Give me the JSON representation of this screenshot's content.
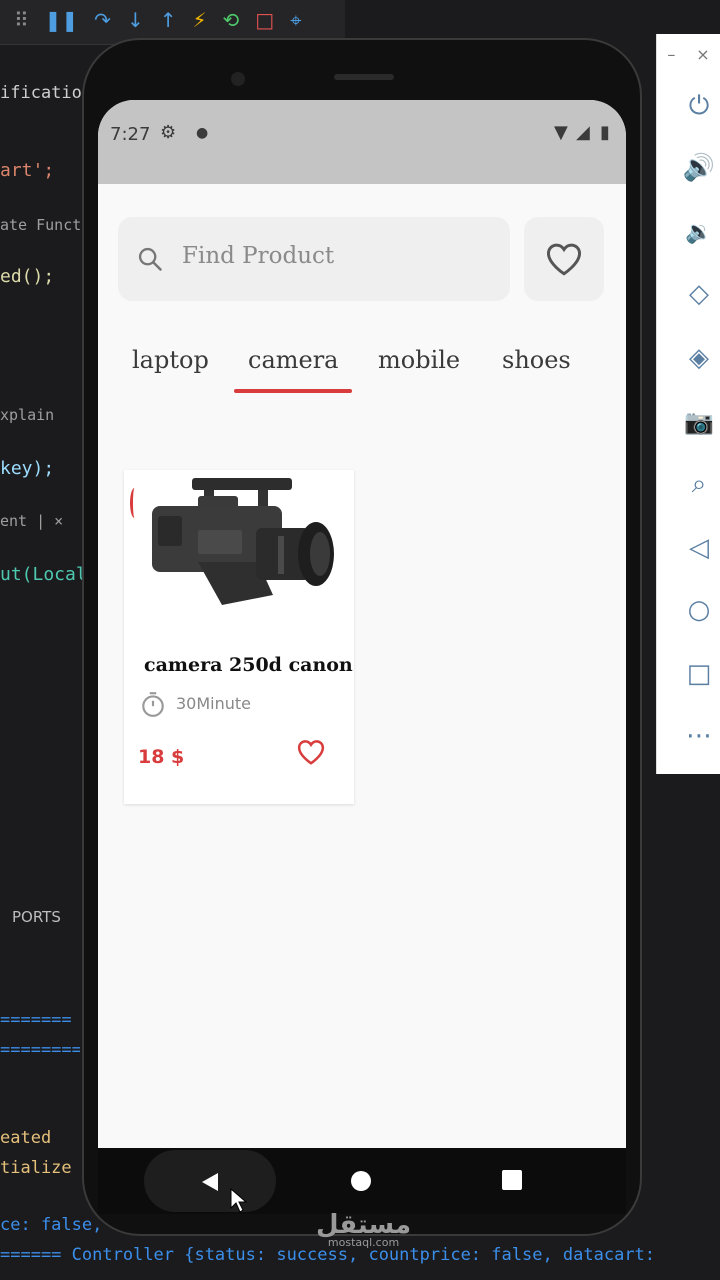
{
  "ide": {
    "file_tab": "ification.d",
    "code_lines": [
      {
        "text": "art';",
        "color": "#d9846b"
      },
      {
        "text": "ate Functio",
        "color": "#9e9e9e"
      },
      {
        "text": "ed();",
        "color": "#dcdcaa"
      },
      {
        "text": "xplain",
        "color": "#9e9e9e"
      },
      {
        "text": "key);",
        "color": "#9cdcfe"
      },
      {
        "text": "ent | ×",
        "color": "#9e9e9e"
      },
      {
        "text": "ut(Local",
        "color": "#4ec9b0"
      }
    ],
    "panel_tab": "PORTS",
    "terminal_lines": [
      {
        "text": "======= (",
        "color": "#3b8eea"
      },
      {
        "text": "==========",
        "color": "#3b8eea"
      },
      {
        "text": "eated",
        "color": "#e5c07b"
      },
      {
        "text": "tialize",
        "color": "#e5c07b"
      },
      {
        "text": "ce: false,",
        "color": "#3b8eea"
      },
      {
        "text": "====== Controller {status: success, countprice: false, datacart:",
        "color": "#3b8eea"
      }
    ]
  },
  "status_bar": {
    "time": "7:27"
  },
  "search": {
    "placeholder": "Find Product"
  },
  "categories": {
    "items": [
      "laptop",
      "camera",
      "mobile",
      "shoes"
    ],
    "selected": "camera"
  },
  "products": [
    {
      "name": "camera 250d canon",
      "prep_time": "30Minute",
      "price": "18 $"
    }
  ],
  "watermark": {
    "text": "مستقل",
    "sub": "mostaql.com"
  },
  "colors": {
    "accent": "#d93c3c",
    "screen_bg": "#f9f9f9",
    "status_bar": "#c4c4c4",
    "search_bg": "#efefef"
  }
}
